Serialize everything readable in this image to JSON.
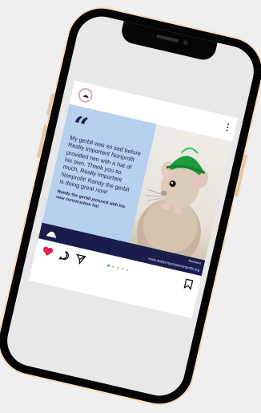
{
  "post": {
    "quote_mark": "“",
    "quote": "My gerbil was so sad before Really Important Nonprofit provided him with a hat of his own. Thank you so much, Really Important Nonprofit! Randy the gerbil is doing great now!",
    "caption": "Randy the gerbil pictured with his new construction hat",
    "credit": "illustrates",
    "website": "www.reallyimportantnonprofit.org",
    "carousel": {
      "total": 5,
      "active": 1
    }
  },
  "colors": {
    "panel": "#b6d0ee",
    "navy": "#1a1d4c",
    "heart": "#e0224f",
    "hat": "#1c9b3b",
    "frame": "#f5ddc3"
  },
  "icons": [
    "logo-icon",
    "more-icon",
    "quote-icon",
    "heart-icon",
    "comment-icon",
    "share-icon",
    "bookmark-icon"
  ]
}
